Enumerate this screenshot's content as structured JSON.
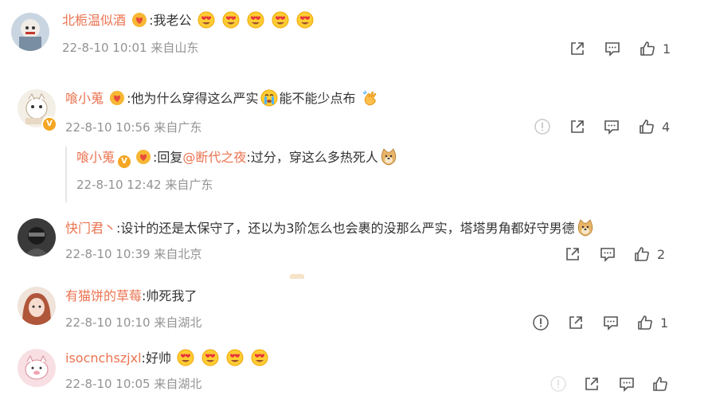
{
  "comments": [
    {
      "user": "北栀温似酒",
      "text": ":我老公",
      "time": "22-8-10 10:01",
      "location": "来自山东",
      "likes": "1"
    },
    {
      "user": "喰小蒐",
      "text_a": ":他为什么穿得这么严实",
      "text_b": "能不能少点布",
      "time": "22-8-10 10:56",
      "location": "来自广东",
      "likes": "4",
      "reply": {
        "user": "喰小蒐",
        "prefix": ":回复",
        "mention": "@断代之夜",
        "text": ":过分，穿这么多热死人",
        "time": "22-8-10 12:42",
        "location": "来自广东"
      }
    },
    {
      "user": "快门君丶",
      "text": ":设计的还是太保守了，还以为3阶怎么也会裹的没那么严实，塔塔男角都好守男德",
      "time": "22-8-10 10:39",
      "location": "来自北京",
      "likes": "2"
    },
    {
      "user": "有猫饼的草莓",
      "text": ":帅死我了",
      "time": "22-8-10 10:10",
      "location": "来自湖北",
      "likes": "1"
    },
    {
      "user": "isocnchszjxl",
      "text": ":好帅",
      "time": "22-8-10 10:05",
      "location": "来自湖北"
    }
  ],
  "colors": {
    "username": "#eb7350",
    "meta": "#939393",
    "badge": "#f5a623"
  }
}
